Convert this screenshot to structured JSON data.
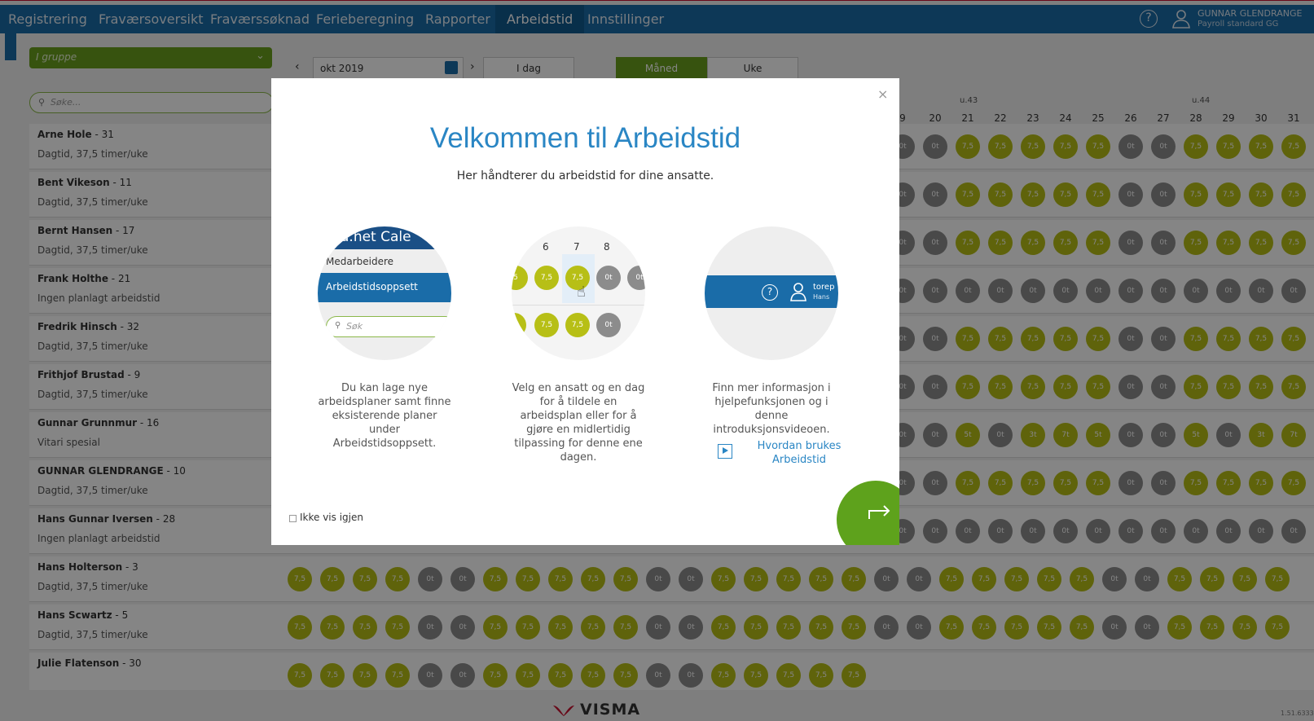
{
  "nav": {
    "items": [
      "Registrering",
      "Fraværsoversikt",
      "Fraværssøknad",
      "Ferieberegning",
      "Rapporter",
      "Arbeidstid",
      "Innstillinger"
    ],
    "active": "Arbeidstid",
    "user_name": "GUNNAR GLENDRANGE",
    "user_sub": "Payroll standard GG"
  },
  "toolbar": {
    "group_select": "I gruppe",
    "search_placeholder": "Søke...",
    "date_value": "okt 2019",
    "today_label": "I dag",
    "month_label": "Måned",
    "week_label": "Uke"
  },
  "calendar": {
    "week_labels": [
      "u.43",
      "u.44"
    ],
    "day_labels": [
      "9",
      "20",
      "21",
      "22",
      "23",
      "24",
      "25",
      "26",
      "27",
      "28",
      "29",
      "30",
      "31"
    ]
  },
  "employees": [
    {
      "name": "Arne Hole",
      "id": "- 31",
      "plan": "Dagtid, 37,5 timer/uke"
    },
    {
      "name": "Bent Vikeson",
      "id": "- 11",
      "plan": "Dagtid, 37,5 timer/uke"
    },
    {
      "name": "Bernt Hansen",
      "id": "- 17",
      "plan": "Dagtid, 37,5 timer/uke"
    },
    {
      "name": "Frank Holthe",
      "id": "- 21",
      "plan": "Ingen planlagt arbeidstid"
    },
    {
      "name": "Fredrik Hinsch",
      "id": "- 32",
      "plan": "Dagtid, 37,5 timer/uke"
    },
    {
      "name": "Frithjof Brustad",
      "id": "- 9",
      "plan": "Dagtid, 37,5 timer/uke"
    },
    {
      "name": "Gunnar Grunnmur",
      "id": "- 16",
      "plan": "Vitari spesial"
    },
    {
      "name": "GUNNAR GLENDRANGE",
      "id": "- 10",
      "plan": "Dagtid, 37,5 timer/uke"
    },
    {
      "name": "Hans Gunnar Iversen",
      "id": "- 28",
      "plan": "Ingen planlagt arbeidstid"
    },
    {
      "name": "Hans Holterson",
      "id": "- 3",
      "plan": "Dagtid, 37,5 timer/uke"
    },
    {
      "name": "Hans Scwartz",
      "id": "- 5",
      "plan": "Dagtid, 37,5 timer/uke"
    },
    {
      "name": "Julie Flatenson",
      "id": "- 30",
      "plan": ""
    }
  ],
  "modal": {
    "close": "×",
    "title": "Velkommen til Arbeidstid",
    "subtitle": "Her håndterer du arbeidstid for dine ansatte.",
    "circle1": {
      "header": "a.net Cale",
      "item1": "Medarbeidere",
      "item2": "Arbeidstidsoppsett",
      "search": "Søk"
    },
    "circle2": {
      "days": [
        "6",
        "7",
        "8"
      ],
      "row1": [
        "5",
        "7,5",
        "7,5",
        "0t",
        "0t"
      ],
      "row2": [
        "7,5",
        "7,5",
        "0t"
      ]
    },
    "circle3": {
      "help": "?",
      "user": "torep",
      "user2": "Hans"
    },
    "col1": "Du kan lage nye arbeidsplaner samt finne eksisterende planer under Arbeidstidsoppsett.",
    "col2": "Velg en ansatt og en dag for å tildele en arbeidsplan eller for å gjøre en midlertidig tilpassing for denne ene dagen.",
    "col3": "Finn mer informasjon i hjelpefunksjonen og i denne introduksjonsvideoen.",
    "link": "Hvordan brukes Arbeidstid",
    "checkbox_label": "Ikke vis igjen"
  },
  "footer": {
    "brand": "VISMA",
    "version": "1.51.6333"
  },
  "colors": {
    "nav": "#1a6ca8",
    "green": "#6aa01e",
    "yellow_cell": "#b7bf16",
    "grey_cell": "#8c8c8c"
  }
}
